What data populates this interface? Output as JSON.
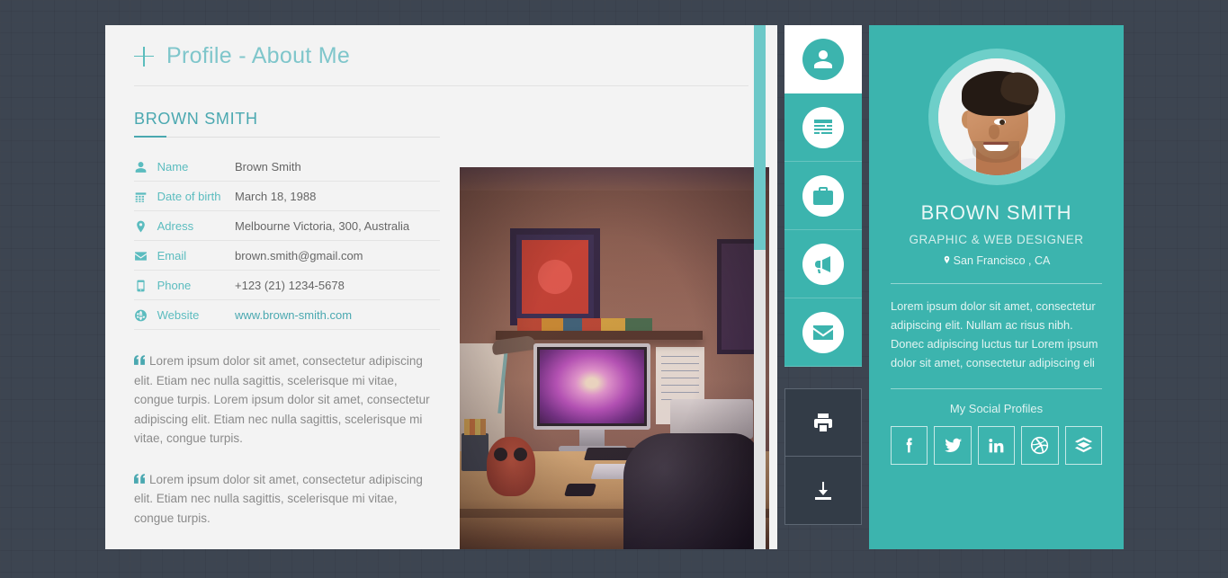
{
  "page": {
    "header_title": "Profile - About Me",
    "plus_icon": "plus-icon",
    "section_title": "BROWN SMITH"
  },
  "info_table": {
    "rows": [
      {
        "icon": "person-icon",
        "label": "Name",
        "value": "Brown Smith",
        "is_link": false
      },
      {
        "icon": "calendar-icon",
        "label": "Date of birth",
        "value": "March 18, 1988",
        "is_link": false
      },
      {
        "icon": "map-pin-icon",
        "label": "Adress",
        "value": "Melbourne Victoria, 300, Australia",
        "is_link": false
      },
      {
        "icon": "envelope-icon",
        "label": "Email",
        "value": "brown.smith@gmail.com",
        "is_link": false
      },
      {
        "icon": "phone-icon",
        "label": "Phone",
        "value": "+123 (21) 1234-5678",
        "is_link": false
      },
      {
        "icon": "globe-icon",
        "label": "Website",
        "value": "www.brown-smith.com",
        "is_link": true
      }
    ]
  },
  "quotes": [
    "Lorem ipsum dolor sit amet, consectetur adipiscing elit. Etiam nec nulla sagittis, scelerisque mi vitae, congue turpis. Lorem ipsum dolor sit amet, consectetur adipiscing elit. Etiam nec nulla sagittis, scelerisque mi vitae, congue turpis.",
    "Lorem ipsum dolor sit amet, consectetur adipiscing elit. Etiam nec nulla sagittis, scelerisque mi vitae, congue turpis."
  ],
  "photo": {
    "alt": "Desk workspace with iMac, owl figurine and office chair"
  },
  "nav": {
    "items": [
      {
        "name": "profile",
        "icon": "person-icon",
        "active": true
      },
      {
        "name": "resume",
        "icon": "resume-icon",
        "active": false
      },
      {
        "name": "portfolio",
        "icon": "briefcase-icon",
        "active": false
      },
      {
        "name": "services",
        "icon": "megaphone-icon",
        "active": false
      },
      {
        "name": "contact",
        "icon": "envelope-icon",
        "active": false
      }
    ],
    "actions": [
      {
        "name": "print",
        "icon": "printer-icon"
      },
      {
        "name": "download",
        "icon": "download-icon"
      }
    ]
  },
  "profile_card": {
    "avatar": "avatar-photo",
    "name": "BROWN SMITH",
    "role": "GRAPHIC & WEB DESIGNER",
    "location": "San Francisco , CA",
    "bio": "Lorem ipsum dolor sit amet, consectetur adipiscing elit. Nullam ac risus nibh. Donec adipiscing luctus tur Lorem ipsum dolor sit amet, consectetur adipiscing eli",
    "social_title": "My Social Profiles",
    "socials": [
      {
        "name": "facebook",
        "icon": "facebook-icon"
      },
      {
        "name": "twitter",
        "icon": "twitter-icon"
      },
      {
        "name": "linkedin",
        "icon": "linkedin-icon"
      },
      {
        "name": "dribbble",
        "icon": "dribbble-icon"
      },
      {
        "name": "envato",
        "icon": "envato-icon"
      }
    ]
  },
  "colors": {
    "teal": "#3cb4ae",
    "teal_light": "#6cc8c8",
    "teal_text": "#4aa8b0",
    "dark_bg": "#3d4551",
    "panel_bg": "#f3f3f3",
    "action_bg": "#333c47"
  },
  "scrollbar": {
    "thumb_label": "scroll-thumb"
  }
}
